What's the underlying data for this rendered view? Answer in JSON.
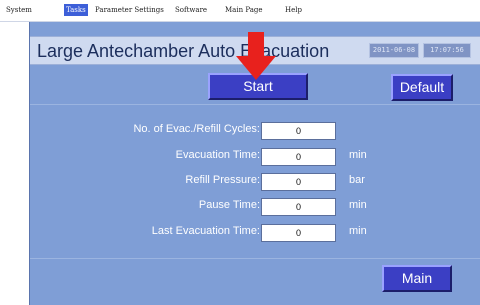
{
  "menubar": {
    "items": [
      {
        "label": "System"
      },
      {
        "label": "Tasks",
        "active": true
      },
      {
        "label": "Parameter Settings"
      },
      {
        "label": "Software"
      },
      {
        "label": "Main Page"
      },
      {
        "label": "Help"
      }
    ]
  },
  "header": {
    "title": "Large Antechamber Auto Evacuation",
    "date": "2011-06-08",
    "time": "17:07:56"
  },
  "buttons": {
    "start_label": "Start",
    "default_label": "Default",
    "main_label": "Main"
  },
  "fields": [
    {
      "label": "No. of Evac./Refill Cycles:",
      "value": "0",
      "unit": ""
    },
    {
      "label": "Evacuation Time:",
      "value": "0",
      "unit": "min"
    },
    {
      "label": "Refill Pressure:",
      "value": "0",
      "unit": "bar"
    },
    {
      "label": "Pause Time:",
      "value": "0",
      "unit": "min"
    },
    {
      "label": "Last Evacuation Time:",
      "value": "0",
      "unit": "min"
    }
  ],
  "colors": {
    "panel_background": "#7f9ed6",
    "title_bar": "#cfdaf0",
    "button": "#3b3fc4",
    "annotation_arrow": "#e8211d",
    "active_menu": "#3d5fd8"
  },
  "annotation": {
    "icon": "red-down-arrow-icon"
  }
}
